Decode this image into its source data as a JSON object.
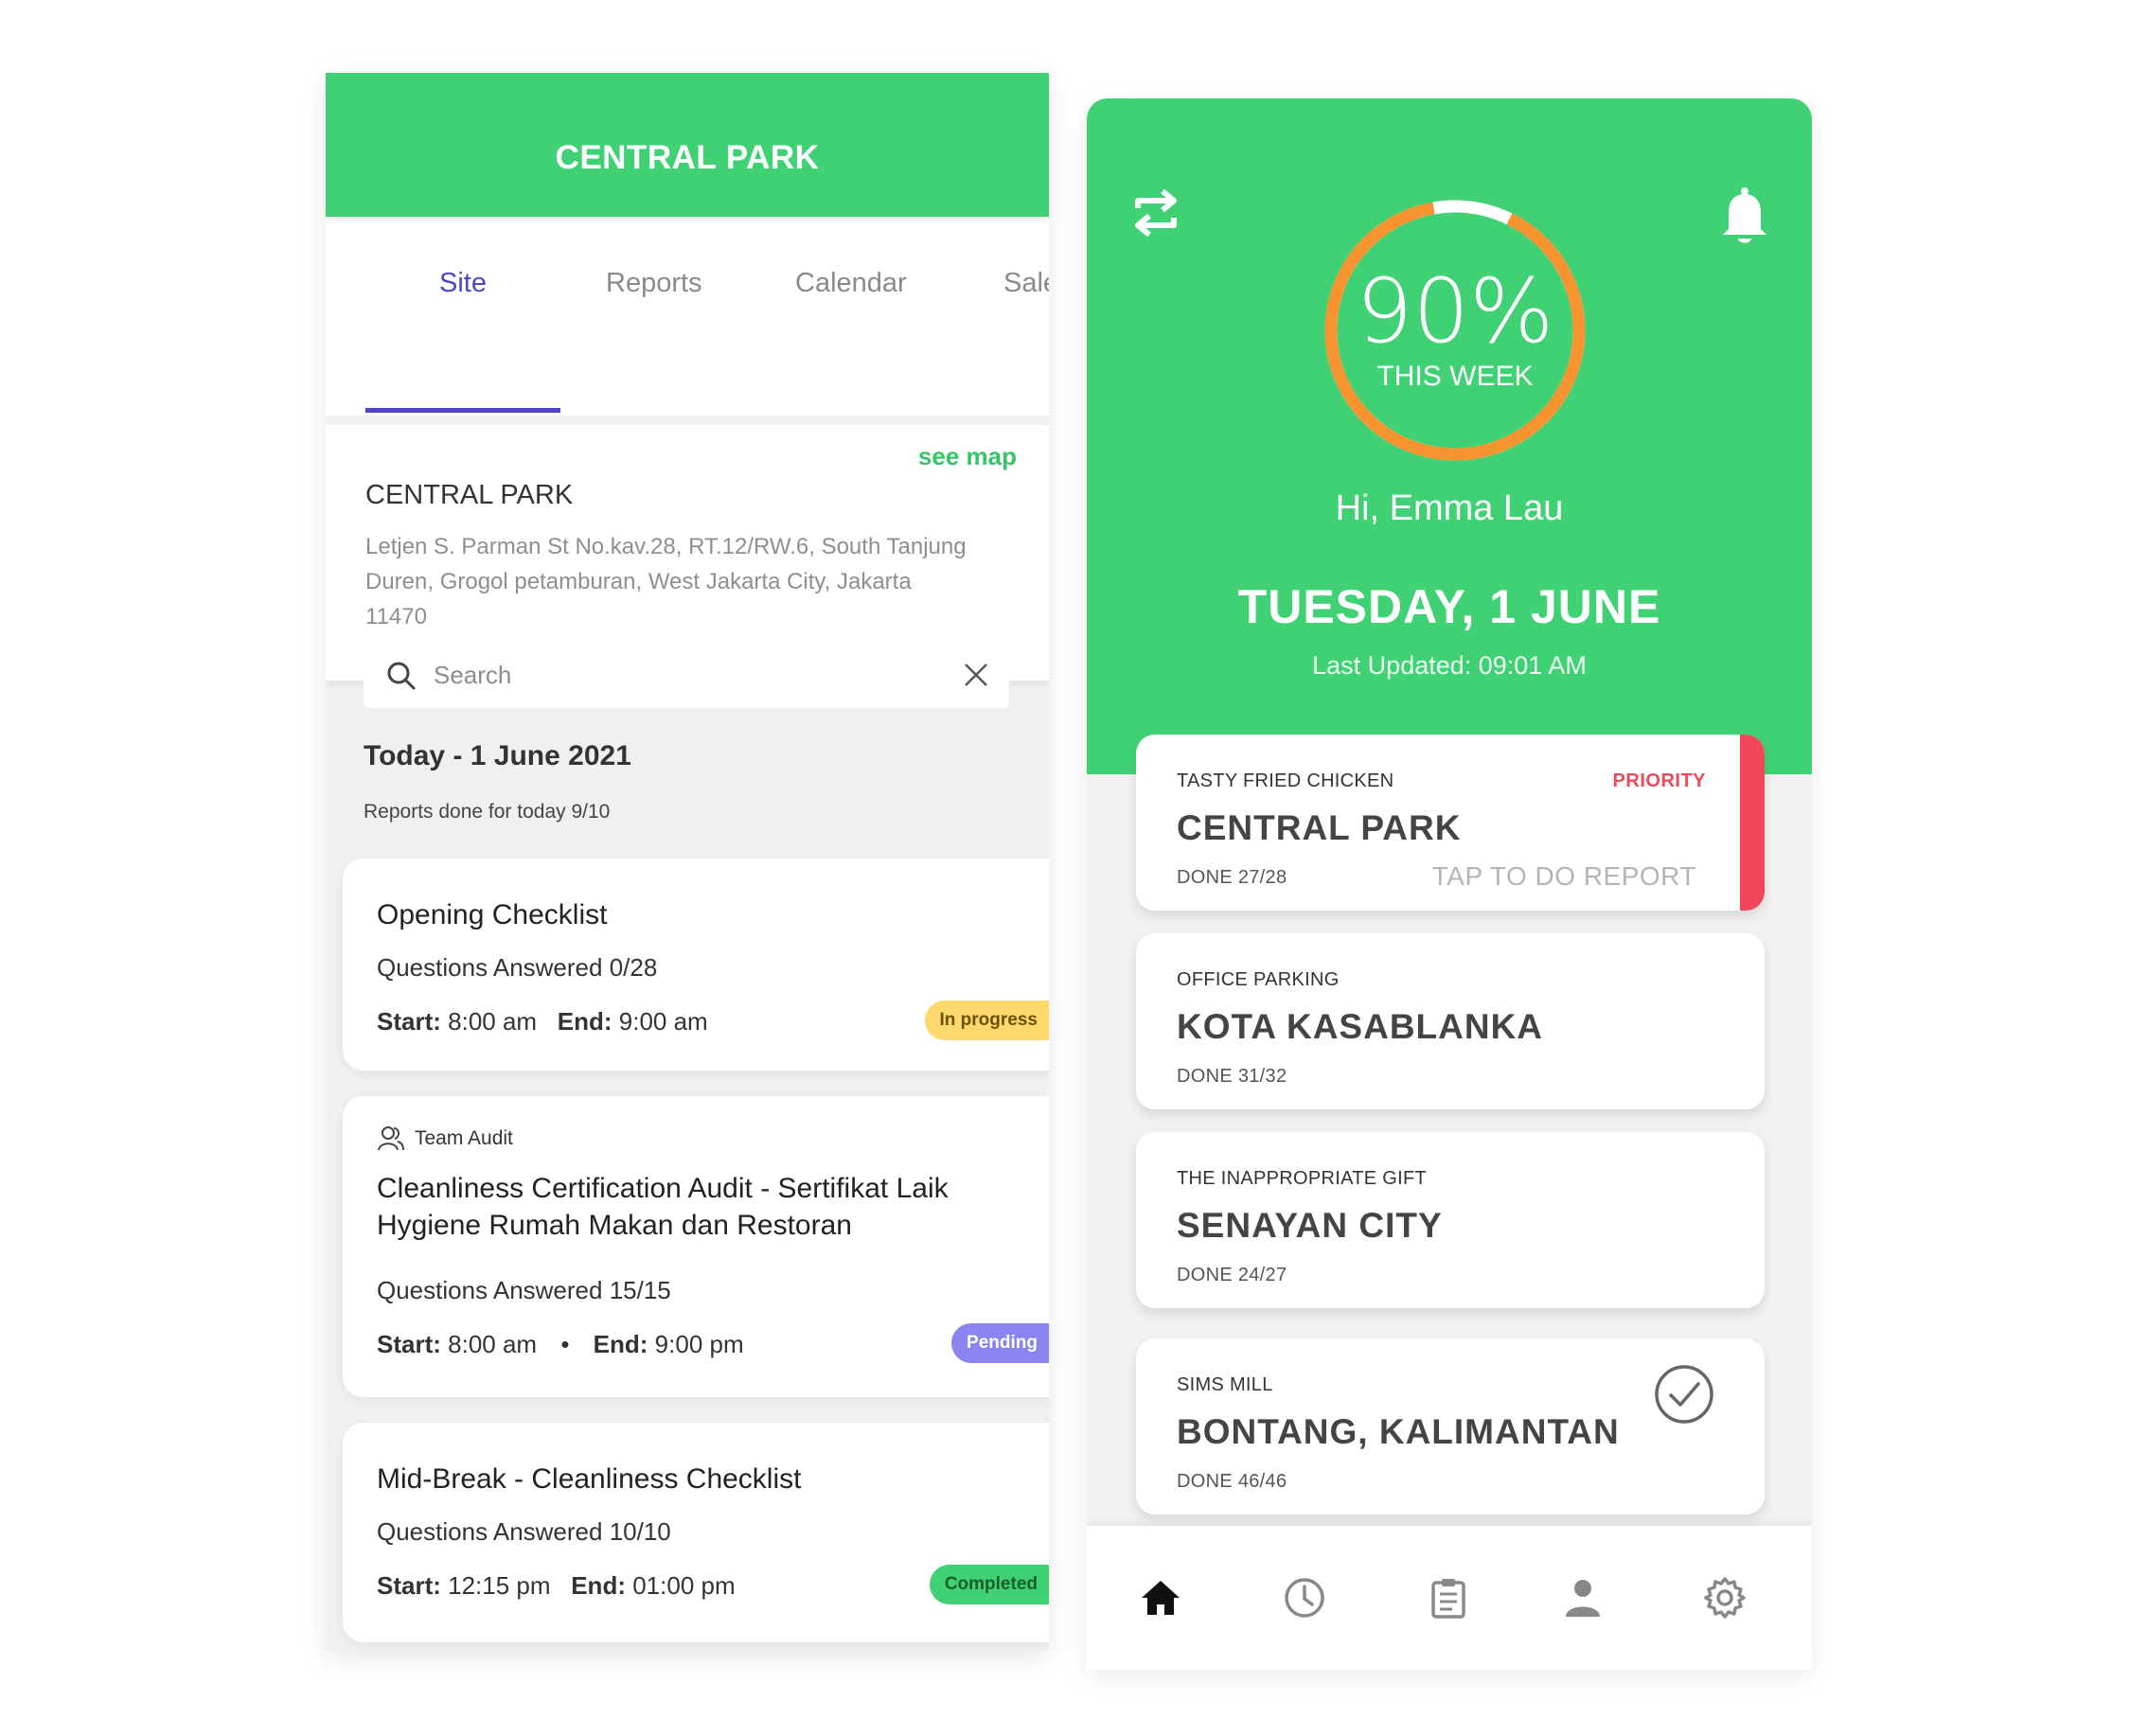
{
  "left": {
    "header_title": "CENTRAL PARK",
    "tabs": [
      {
        "label": "Site",
        "active": true
      },
      {
        "label": "Reports",
        "active": false
      },
      {
        "label": "Calendar",
        "active": false
      },
      {
        "label": "Sale",
        "active": false
      }
    ],
    "site": {
      "see_map": "see map",
      "name": "CENTRAL PARK",
      "address": "Letjen S. Parman St No.kav.28, RT.12/RW.6, South Tanjung Duren, Grogol petamburan, West Jakarta City, Jakarta 11470"
    },
    "search": {
      "placeholder": "Search"
    },
    "today": "Today - 1 June 2021",
    "reports_done": "Reports done for today 9/10",
    "reports": [
      {
        "title": "Opening Checklist",
        "questions": "Questions Answered 0/28",
        "start_label": "Start:",
        "start": "8:00 am",
        "end_label": "End:",
        "end": "9:00 am",
        "status": "In progress"
      },
      {
        "tag": "Team Audit",
        "title": "Cleanliness Certification Audit - Sertifikat Laik Hygiene Rumah Makan dan Restoran",
        "questions": "Questions Answered 15/15",
        "start_label": "Start:",
        "start": "8:00 am",
        "separator": "•",
        "end_label": "End:",
        "end": "9:00 pm",
        "status": "Pending"
      },
      {
        "title": "Mid-Break - Cleanliness Checklist",
        "questions": "Questions Answered 10/10",
        "start_label": "Start:",
        "start": "12:15 pm",
        "end_label": "End:",
        "end": "01:00 pm",
        "status": "Completed"
      }
    ]
  },
  "right": {
    "progress_percent": 90,
    "progress_text": "90%",
    "progress_label": "THIS WEEK",
    "greeting": "Hi, Emma Lau",
    "date": "TUESDAY, 1 JUNE",
    "last_updated": "Last Updated: 09:01 AM",
    "sites": [
      {
        "client": "TASTY FRIED CHICKEN",
        "site": "CENTRAL PARK",
        "done": "DONE 27/28",
        "priority": "PRIORITY",
        "action": "TAP TO DO REPORT"
      },
      {
        "client": "OFFICE PARKING",
        "site": "KOTA KASABLANKA",
        "done": "DONE 31/32"
      },
      {
        "client": "THE INAPPROPRIATE GIFT",
        "site": "SENAYAN CITY",
        "done": "DONE 24/27"
      },
      {
        "client": "SIMS MILL",
        "site": "BONTANG, KALIMANTAN",
        "done": "DONE 46/46",
        "completed": true
      }
    ],
    "nav": [
      "home-icon",
      "clock-icon",
      "clipboard-icon",
      "user-icon",
      "gear-icon"
    ]
  },
  "colors": {
    "brand_green": "#40d174",
    "accent_orange": "#f7942f",
    "tab_active": "#4b45c8",
    "priority_red": "#f0475a",
    "badge_in_progress": "#ffd86b",
    "badge_pending": "#8a84f0",
    "badge_completed": "#40d174"
  }
}
